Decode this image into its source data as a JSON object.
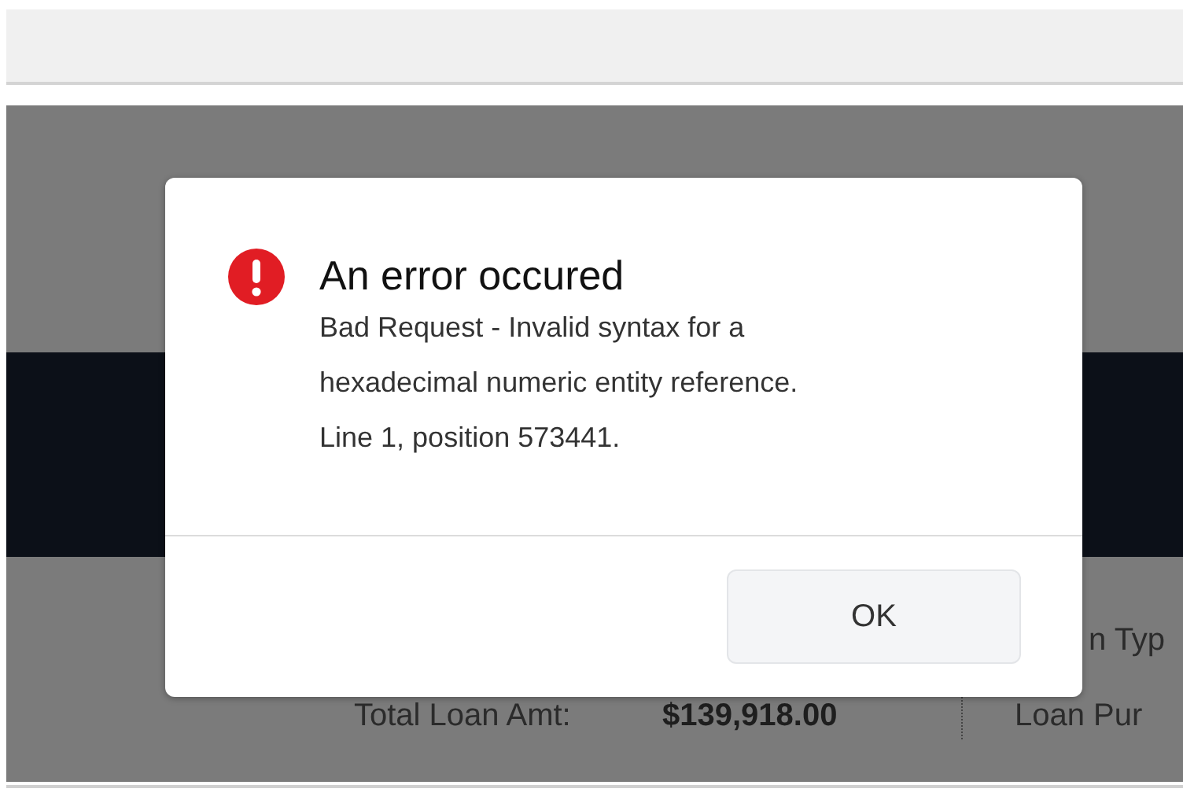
{
  "dialog": {
    "title": "An error occured",
    "message_lines": [
      "Bad Request - Invalid syntax for a",
      "hexadecimal numeric entity reference.",
      "Line 1, position 573441."
    ],
    "buttons": [
      "OK"
    ]
  },
  "background": {
    "loan_amount": {
      "label": "Total Loan Amt:",
      "value": "$139,918.00"
    },
    "column_2": [
      "n Typ",
      "Loan Pur"
    ]
  }
}
